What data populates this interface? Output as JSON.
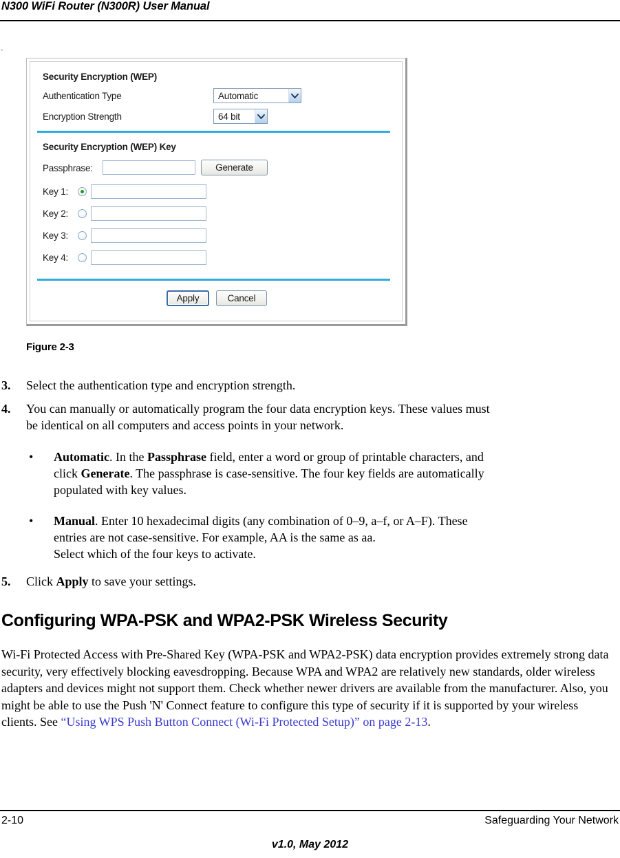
{
  "header": {
    "title": "N300 WiFi Router (N300R) User Manual"
  },
  "screenshot": {
    "section1_title": "Security Encryption (WEP)",
    "auth_type_label": "Authentication Type",
    "auth_type_value": "Automatic",
    "encryption_strength_label": "Encryption Strength",
    "encryption_strength_value": "64 bit",
    "section2_title": "Security Encryption (WEP) Key",
    "passphrase_label": "Passphrase:",
    "passphrase_value": "",
    "generate_label": "Generate",
    "keys": [
      {
        "label": "Key 1:",
        "value": "",
        "selected": true
      },
      {
        "label": "Key 2:",
        "value": "",
        "selected": false
      },
      {
        "label": "Key 3:",
        "value": "",
        "selected": false
      },
      {
        "label": "Key 4:",
        "value": "",
        "selected": false
      }
    ],
    "apply_label": "Apply",
    "cancel_label": "Cancel",
    "divider_color": "#31ABDC"
  },
  "figure": {
    "caption": "Figure 2-3"
  },
  "steps": {
    "step3_num": "3.",
    "step3_text": "Select the authentication type and encryption strength.",
    "step4_num": "4.",
    "step4_line1": "You can manually or automatically program the four data encryption keys. These values must",
    "step4_line2": "be identical on all computers and access points in your network.",
    "bullet_mark": "•",
    "bullet1_lead": "Automatic",
    "bullet1_t1": ". In the ",
    "bullet1_bold2": "Passphrase",
    "bullet1_t2": " field, enter a word or group of printable characters, and",
    "bullet1_line2_pre": "click ",
    "bullet1_bold3": "Generate",
    "bullet1_line2_post": ". The passphrase is case-sensitive. The four key fields are automatically",
    "bullet1_line3": "populated with key values.",
    "bullet2_lead": "Manual",
    "bullet2_t1": ". Enter 10 hexadecimal digits (any combination of 0–9, a–f, or A–F). These",
    "bullet2_line2": "entries are not case-sensitive. For example, AA is the same as aa.",
    "bullet2_line3": "Select which of the four keys to activate.",
    "step5_num": "5.",
    "step5_pre": "Click ",
    "step5_bold": "Apply",
    "step5_post": " to save your settings."
  },
  "section": {
    "heading": "Configuring WPA-PSK and WPA2-PSK Wireless Security",
    "paragraph_pre": "Wi-Fi Protected Access with Pre-Shared Key (WPA-PSK and WPA2-PSK) data encryption provides extremely strong data security, very effectively blocking eavesdropping. Because WPA and WPA2 are relatively new standards, older wireless adapters and devices might not support them. Check whether newer drivers are available from the manufacturer. Also, you might be able to use the Push 'N' Connect feature to configure this type of security if it is supported by your wireless clients. See ",
    "link_text": "“Using WPS Push Button Connect (Wi-Fi Protected Setup)” on page 2-13",
    "paragraph_post": ".",
    "link_color": "#3a3ad0"
  },
  "footer": {
    "page_number": "2-10",
    "chapter": "Safeguarding Your Network",
    "version": "v1.0, May 2012"
  }
}
